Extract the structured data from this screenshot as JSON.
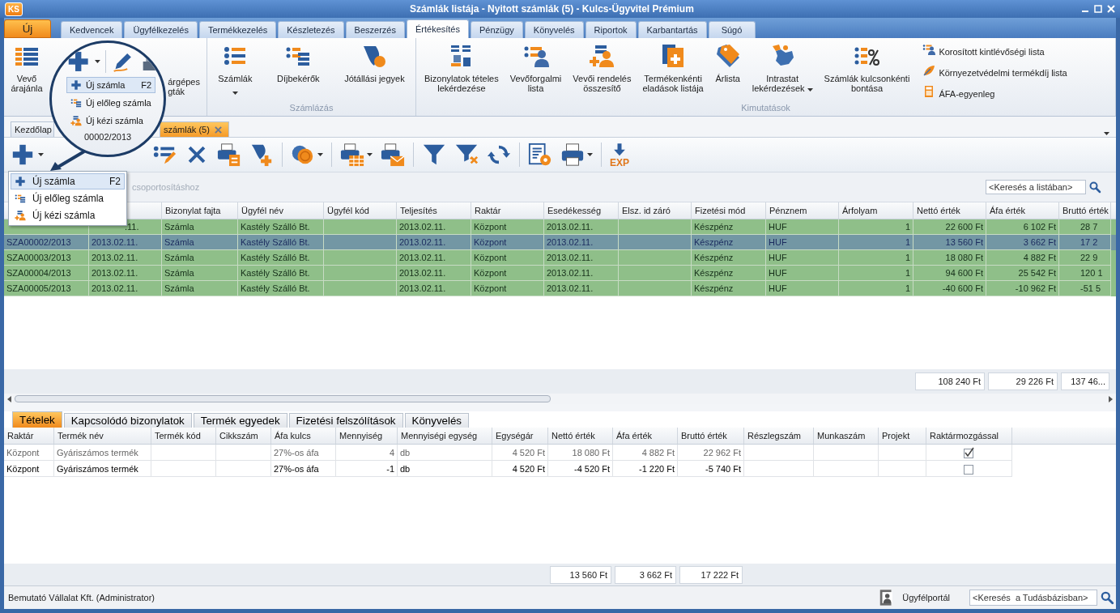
{
  "window": {
    "logo": "KS",
    "title": "Számlák listája - Nyitott számlák (5) - Kulcs-Ügyvitel Prémium"
  },
  "ribbon_tabs": [
    {
      "label": "Új",
      "kind": "app",
      "selected": false
    },
    {
      "label": "Kedvencek",
      "kind": "tab",
      "selected": false
    },
    {
      "label": "Ügyfélkezelés",
      "kind": "tab",
      "selected": false
    },
    {
      "label": "Termékkezelés",
      "kind": "tab",
      "selected": false
    },
    {
      "label": "Készletezés",
      "kind": "tab",
      "selected": false
    },
    {
      "label": "Beszerzés",
      "kind": "tab",
      "selected": false
    },
    {
      "label": "Értékesítés",
      "kind": "tab",
      "selected": true
    },
    {
      "label": "Pénzügy",
      "kind": "tab",
      "selected": false
    },
    {
      "label": "Könyvelés",
      "kind": "tab",
      "selected": false
    },
    {
      "label": "Riportok",
      "kind": "tab",
      "selected": false
    },
    {
      "label": "Karbantartás",
      "kind": "tab",
      "selected": false
    },
    {
      "label": "Súgó",
      "kind": "tab",
      "selected": false
    }
  ],
  "ribbon_groups": [
    {
      "buttons": [
        {
          "lines": [
            "Vevő",
            "árajánla"
          ]
        },
        {
          "lines": [
            "árgépes",
            "gták"
          ]
        }
      ]
    },
    {
      "label": "Számlázás",
      "buttons": [
        {
          "lines": [
            "Számlák"
          ],
          "dropdown": true
        },
        {
          "lines": [
            "Díjbekérők"
          ]
        },
        {
          "lines": [
            "Jótállási jegyek"
          ]
        }
      ]
    },
    {
      "label": "Kimutatások",
      "buttons": [
        {
          "lines": [
            "Bizonylatok tételes",
            "lekérdezése"
          ]
        },
        {
          "lines": [
            "Vevőforgalmi",
            "lista"
          ]
        },
        {
          "lines": [
            "Vevői rendelés",
            "összesítő"
          ]
        },
        {
          "lines": [
            "Termékenkénti",
            "eladások listája"
          ]
        },
        {
          "lines": [
            "Árlista"
          ]
        },
        {
          "lines": [
            "Intrastat",
            "lekérdezések"
          ],
          "dropdown": true
        },
        {
          "lines": [
            "Számlák kulcsonkénti",
            "bontása"
          ]
        }
      ],
      "links": [
        "Korosított kintlévőségi lista",
        "Környezetvédelmi termékdíj lista",
        "ÁFA-egyenleg"
      ]
    }
  ],
  "magnifier": {
    "menu": [
      {
        "label": "Új számla",
        "shortcut": "F2",
        "selected": true
      },
      {
        "label": "Új előleg számla",
        "selected": false
      },
      {
        "label": "Új kézi számla",
        "selected": false
      }
    ],
    "document_number": "00002/2013"
  },
  "document_tabs": [
    {
      "label": "Kezdőlap",
      "selected": false
    },
    {
      "label": "számlák (5)",
      "selected": true,
      "closable": true
    }
  ],
  "toolbar": {
    "export_label": "EXP"
  },
  "new_menu": [
    {
      "label": "Új számla",
      "shortcut": "F2",
      "selected": true
    },
    {
      "label": "Új előleg számla",
      "selected": false
    },
    {
      "label": "Új kézi számla",
      "selected": false
    }
  ],
  "group_panel": {
    "hint": "csoportosításhoz"
  },
  "search": {
    "placeholder": "<Keresés a listában>"
  },
  "table": {
    "columns": [
      null,
      null,
      "Bizonylat fajta",
      "Ügyfél név",
      "Ügyfél kód",
      "Teljesítés",
      "Raktár",
      "Esedékesség",
      "Elsz. id záró",
      "Fizetési mód",
      "Pénznem",
      "Árfolyam",
      "Nettó érték",
      "Áfa érték",
      "Bruttó érték"
    ],
    "rows": [
      {
        "selected": false,
        "cells": [
          null,
          ".11.",
          "Számla",
          "Kastély Szálló Bt.",
          null,
          "2013.02.11.",
          "Központ",
          "2013.02.11.",
          null,
          "Készpénz",
          "HUF",
          "1",
          "22 600 Ft",
          "6 102 Ft",
          "28 7"
        ]
      },
      {
        "selected": true,
        "cells": [
          "SZA00002/2013",
          "2013.02.11.",
          "Számla",
          "Kastély Szálló Bt.",
          null,
          "2013.02.11.",
          "Központ",
          "2013.02.11.",
          null,
          "Készpénz",
          "HUF",
          "1",
          "13 560 Ft",
          "3 662 Ft",
          "17 2"
        ]
      },
      {
        "selected": false,
        "cells": [
          "SZA00003/2013",
          "2013.02.11.",
          "Számla",
          "Kastély Szálló Bt.",
          null,
          "2013.02.11.",
          "Központ",
          "2013.02.11.",
          null,
          "Készpénz",
          "HUF",
          "1",
          "18 080 Ft",
          "4 882 Ft",
          "22 9"
        ]
      },
      {
        "selected": false,
        "cells": [
          "SZA00004/2013",
          "2013.02.11.",
          "Számla",
          "Kastély Szálló Bt.",
          null,
          "2013.02.11.",
          "Központ",
          "2013.02.11.",
          null,
          "Készpénz",
          "HUF",
          "1",
          "94 600 Ft",
          "25 542 Ft",
          "120 1"
        ]
      },
      {
        "selected": false,
        "cells": [
          "SZA00005/2013",
          "2013.02.11.",
          "Számla",
          "Kastély Szálló Bt.",
          null,
          "2013.02.11.",
          "Központ",
          "2013.02.11.",
          null,
          "Készpénz",
          "HUF",
          "1",
          "-40 600 Ft",
          "-10 962 Ft",
          "-51 5"
        ]
      }
    ],
    "totals": [
      "108 240 Ft",
      "29 226 Ft",
      "137 46..."
    ]
  },
  "detail_tabs": [
    {
      "label": "Tételek",
      "selected": true
    },
    {
      "label": "Kapcsolódó bizonylatok",
      "selected": false
    },
    {
      "label": "Termék egyedek",
      "selected": false
    },
    {
      "label": "Fizetési felszólítások",
      "selected": false
    },
    {
      "label": "Könyvelés",
      "selected": false
    }
  ],
  "detail": {
    "columns": [
      "Raktár",
      "Termék név",
      "Termék kód",
      "Cikkszám",
      "Áfa kulcs",
      "Mennyiség",
      "Mennyiségi egység",
      "Egységár",
      "Nettó érték",
      "Áfa érték",
      "Bruttó érték",
      "Részlegszám",
      "Munkaszám",
      "Projekt",
      "Raktármozgással"
    ],
    "rows": [
      {
        "selected": true,
        "checked": true,
        "cells": [
          "Központ",
          "Gyáriszámos termék",
          null,
          null,
          "27%-os áfa",
          "4",
          "db",
          "4 520 Ft",
          "18 080 Ft",
          "4 882 Ft",
          "22 962 Ft",
          null,
          null,
          null
        ]
      },
      {
        "selected": false,
        "checked": false,
        "cells": [
          "Központ",
          "Gyáriszámos termék",
          null,
          null,
          "27%-os áfa",
          "-1",
          "db",
          "4 520 Ft",
          "-4 520 Ft",
          "-1 220 Ft",
          "-5 740 Ft",
          null,
          null,
          null
        ]
      }
    ],
    "totals": [
      "13 560 Ft",
      "3 662 Ft",
      "17 222 Ft"
    ]
  },
  "status_bar": {
    "company": "Bemutató Vállalat Kft. (Administrator)",
    "portal": "Ügyfélportál",
    "search_placeholder": "<Keresés  a Tudásbázisban>"
  }
}
